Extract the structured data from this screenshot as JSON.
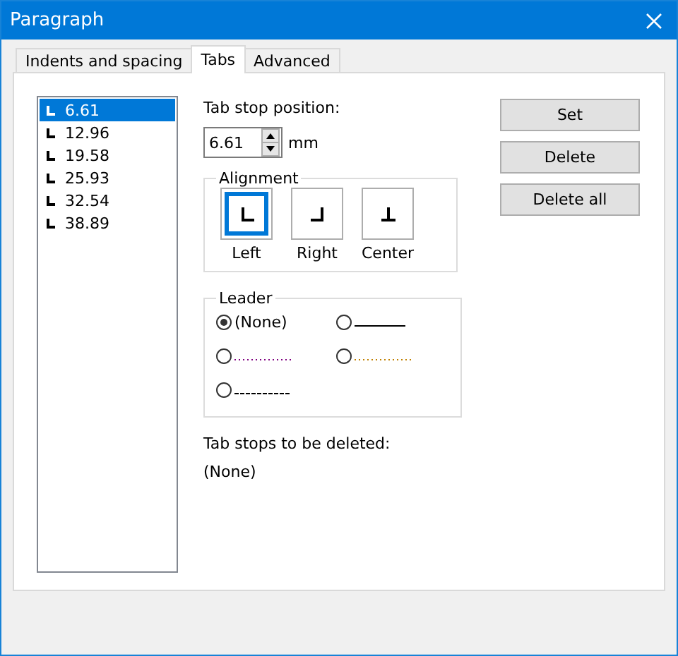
{
  "window": {
    "title": "Paragraph"
  },
  "tabs": [
    {
      "label": "Indents and spacing",
      "selected": false
    },
    {
      "label": "Tabs",
      "selected": true
    },
    {
      "label": "Advanced",
      "selected": false
    }
  ],
  "tab_stops": [
    {
      "value": "6.61",
      "selected": true
    },
    {
      "value": "12.96",
      "selected": false
    },
    {
      "value": "19.58",
      "selected": false
    },
    {
      "value": "25.93",
      "selected": false
    },
    {
      "value": "32.54",
      "selected": false
    },
    {
      "value": "38.89",
      "selected": false
    }
  ],
  "position": {
    "label": "Tab stop position:",
    "value": "6.61",
    "unit": "mm"
  },
  "alignment": {
    "title": "Alignment",
    "options": [
      {
        "kind": "left",
        "label": "Left",
        "selected": true
      },
      {
        "kind": "right",
        "label": "Right",
        "selected": false
      },
      {
        "kind": "center",
        "label": "Center",
        "selected": false
      }
    ]
  },
  "leader": {
    "title": "Leader",
    "options": [
      {
        "kind": "none",
        "label": "(None)",
        "selected": true
      },
      {
        "kind": "solid",
        "color": "#000000",
        "selected": false
      },
      {
        "kind": "dotted",
        "color": "#800080",
        "selected": false
      },
      {
        "kind": "dotted",
        "color": "#c08000",
        "selected": false
      },
      {
        "kind": "dashed",
        "color": "#000000",
        "selected": false
      }
    ]
  },
  "to_delete": {
    "label": "Tab stops to be deleted:",
    "value": "(None)"
  },
  "buttons": [
    "Set",
    "Delete",
    "Delete all"
  ]
}
